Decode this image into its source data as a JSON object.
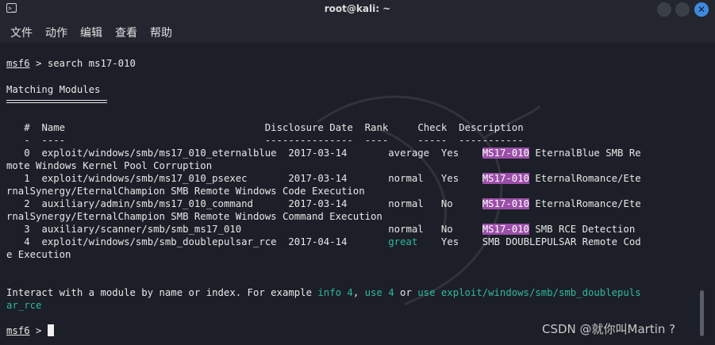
{
  "window": {
    "title": "root@kali: ~",
    "terminal_icon": "terminal-icon"
  },
  "menubar": [
    "文件",
    "动作",
    "编辑",
    "查看",
    "帮助"
  ],
  "terminal": {
    "prompt_cmd": "search ms17-010",
    "prompt_prefix": "msf6",
    "heading": "Matching Modules",
    "header": {
      "num": "#",
      "name": "Name",
      "date": "Disclosure Date",
      "rank": "Rank",
      "check": "Check",
      "desc": "Description"
    },
    "rows": [
      {
        "id": "0",
        "name": "exploit/windows/smb/ms17_010_eternalblue",
        "date": "2017-03-14",
        "rank": "average",
        "check": "Yes",
        "tag": "MS17-010",
        "desc": " EternalBlue SMB Re",
        "wrap": "mote Windows Kernel Pool Corruption"
      },
      {
        "id": "1",
        "name": "exploit/windows/smb/ms17_010_psexec",
        "date": "2017-03-14",
        "rank": "normal",
        "check": "Yes",
        "tag": "MS17-010",
        "desc": " EternalRomance/Ete",
        "wrap": "rnalSynergy/EternalChampion SMB Remote Windows Code Execution"
      },
      {
        "id": "2",
        "name": "auxiliary/admin/smb/ms17_010_command",
        "date": "2017-03-14",
        "rank": "normal",
        "check": "No",
        "tag": "MS17-010",
        "desc": " EternalRomance/Ete",
        "wrap": "rnalSynergy/EternalChampion SMB Remote Windows Command Execution"
      },
      {
        "id": "3",
        "name": "auxiliary/scanner/smb/smb_ms17_010",
        "date": "",
        "rank": "normal",
        "check": "No",
        "tag": "MS17-010",
        "desc": " SMB RCE Detection",
        "wrap": ""
      },
      {
        "id": "4",
        "name": "exploit/windows/smb/smb_doublepulsar_rce",
        "date": "2017-04-14",
        "rank": "great",
        "check": "Yes",
        "tag": "",
        "desc": "SMB DOUBLEPULSAR Remote Cod",
        "wrap": "e Execution"
      }
    ],
    "interact": {
      "p1": "Interact with a module by name or index. For example ",
      "info": "info 4",
      "comma": ", ",
      "use4": "use 4",
      "or": " or ",
      "usepath1": "use exploit/windows/smb/smb_doublepuls",
      "usepath2": "ar_rce"
    }
  },
  "watermark": "CSDN @就你叫Martin ?"
}
